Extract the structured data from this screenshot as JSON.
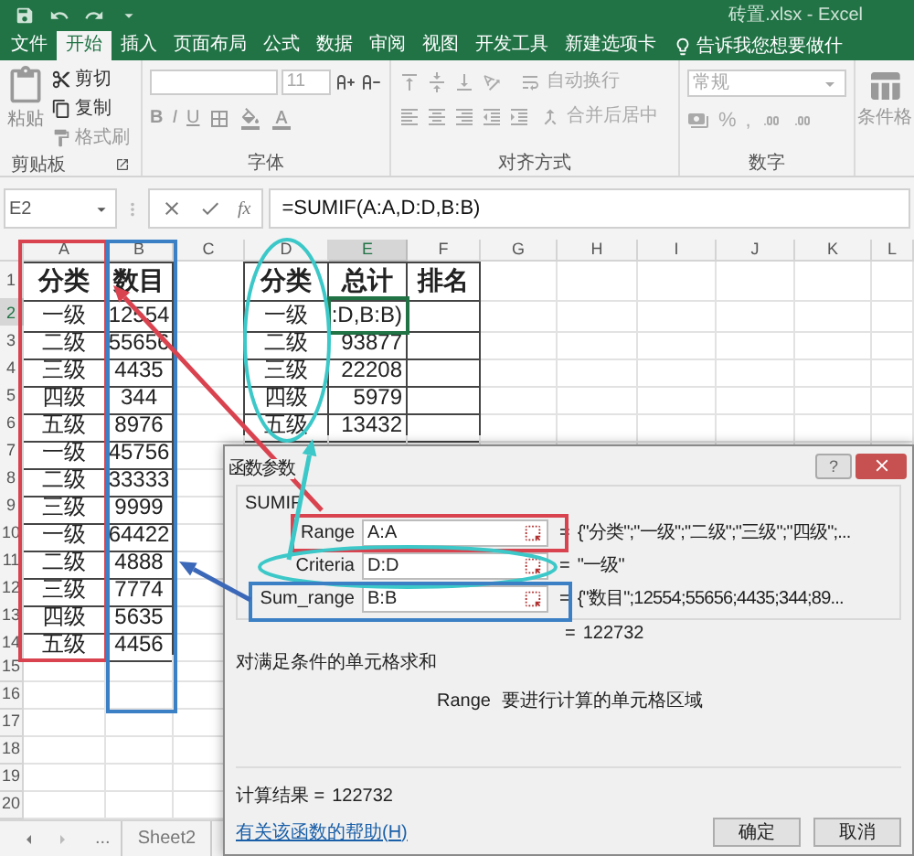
{
  "window": {
    "title": "砖置.xlsx - Excel"
  },
  "ribbon_tabs": [
    {
      "label": "文件",
      "selected": false
    },
    {
      "label": "开始",
      "selected": true
    },
    {
      "label": "插入",
      "selected": false
    },
    {
      "label": "页面布局",
      "selected": false
    },
    {
      "label": "公式",
      "selected": false
    },
    {
      "label": "数据",
      "selected": false
    },
    {
      "label": "审阅",
      "selected": false
    },
    {
      "label": "视图",
      "selected": false
    },
    {
      "label": "开发工具",
      "selected": false
    },
    {
      "label": "新建选项卡",
      "selected": false
    }
  ],
  "tell_me": "告诉我您想要做什",
  "clipboard": {
    "paste": "粘贴",
    "cut": "剪切",
    "copy": "复制",
    "format_painter": "格式刷",
    "label": "剪贴板"
  },
  "font": {
    "size": "11",
    "bold": "B",
    "italic": "I",
    "underline": "U",
    "label": "字体"
  },
  "alignment": {
    "wrap_text": "自动换行",
    "merge_center": "合并后居中",
    "label": "对齐方式"
  },
  "number": {
    "format": "常规",
    "percent": "%",
    "comma": ",",
    "label": "数字"
  },
  "styles": {
    "conditional_formatting": "条件格"
  },
  "formula_bar": {
    "name_box": "E2",
    "fx": "fx",
    "formula": "=SUMIF(A:A,D:D,B:B)"
  },
  "sheet": {
    "columns": [
      "A",
      "B",
      "C",
      "D",
      "E",
      "F",
      "G",
      "H",
      "I",
      "J",
      "K",
      "L"
    ],
    "rows": [
      {
        "number": "1",
        "cells": [
          {
            "text": "分类",
            "selected": false
          },
          {
            "text": "数目",
            "selected": false
          },
          {
            "text": "",
            "selected": false
          },
          {
            "text": "分类",
            "selected": false
          },
          {
            "text": "总计",
            "selected": false
          },
          {
            "text": "排名",
            "selected": false
          }
        ]
      },
      {
        "number": "2",
        "cells": [
          {
            "text": "一级",
            "selected": false
          },
          {
            "text": "12554",
            "selected": false
          },
          {
            "text": "",
            "selected": false
          },
          {
            "text": "一级",
            "selected": false
          },
          {
            "text": ":D,B:B)",
            "selected": true
          }
        ]
      },
      {
        "number": "3",
        "cells": [
          {
            "text": "二级",
            "selected": false
          },
          {
            "text": "55656",
            "selected": false
          },
          {
            "text": "",
            "selected": false
          },
          {
            "text": "二级",
            "selected": false
          },
          {
            "text": "93877",
            "selected": false
          }
        ]
      },
      {
        "number": "4",
        "cells": [
          {
            "text": "三级",
            "selected": false
          },
          {
            "text": "4435",
            "selected": false
          },
          {
            "text": "",
            "selected": false
          },
          {
            "text": "三级",
            "selected": false
          },
          {
            "text": "22208",
            "selected": false
          }
        ]
      },
      {
        "number": "5",
        "cells": [
          {
            "text": "四级",
            "selected": false
          },
          {
            "text": "344",
            "selected": false
          },
          {
            "text": "",
            "selected": false
          },
          {
            "text": "四级",
            "selected": false
          },
          {
            "text": "5979",
            "selected": false
          }
        ]
      },
      {
        "number": "6",
        "cells": [
          {
            "text": "五级",
            "selected": false
          },
          {
            "text": "8976",
            "selected": false
          },
          {
            "text": "",
            "selected": false
          },
          {
            "text": "五级",
            "selected": false
          },
          {
            "text": "13432",
            "selected": false
          }
        ]
      },
      {
        "number": "7",
        "cells": [
          {
            "text": "一级",
            "selected": false
          },
          {
            "text": "45756",
            "selected": false
          }
        ]
      },
      {
        "number": "8",
        "cells": [
          {
            "text": "二级",
            "selected": false
          },
          {
            "text": "33333",
            "selected": false
          }
        ]
      },
      {
        "number": "9",
        "cells": [
          {
            "text": "三级",
            "selected": false
          },
          {
            "text": "9999",
            "selected": false
          }
        ]
      },
      {
        "number": "10",
        "cells": [
          {
            "text": "一级",
            "selected": false
          },
          {
            "text": "64422",
            "selected": false
          }
        ]
      },
      {
        "number": "11",
        "cells": [
          {
            "text": "二级",
            "selected": false
          },
          {
            "text": "4888",
            "selected": false
          }
        ]
      },
      {
        "number": "12",
        "cells": [
          {
            "text": "三级",
            "selected": false
          },
          {
            "text": "7774",
            "selected": false
          }
        ]
      },
      {
        "number": "13",
        "cells": [
          {
            "text": "四级",
            "selected": false
          },
          {
            "text": "5635",
            "selected": false
          }
        ]
      },
      {
        "number": "14",
        "cells": [
          {
            "text": "五级",
            "selected": false
          },
          {
            "text": "4456",
            "selected": false
          }
        ]
      },
      {
        "number": "15",
        "cells": []
      },
      {
        "number": "16",
        "cells": []
      },
      {
        "number": "17",
        "cells": []
      },
      {
        "number": "18",
        "cells": []
      },
      {
        "number": "19",
        "cells": []
      },
      {
        "number": "20",
        "cells": []
      }
    ]
  },
  "sheet_tabs": {
    "more": "...",
    "tabs": [
      {
        "label": "Sheet2",
        "selected": false
      }
    ]
  },
  "dialog": {
    "title": "函数参数",
    "help": "?",
    "function": "SUMIF",
    "arguments": [
      {
        "label": "Range",
        "value": "A:A",
        "equals": "=",
        "result": "{\"分类\";\"一级\";\"二级\";\"三级\";\"四级\";..."
      },
      {
        "label": "Criteria",
        "value": "D:D",
        "equals": "=",
        "result": "\"一级\""
      },
      {
        "label": "Sum_range",
        "value": "B:B",
        "equals": "=",
        "result": "{\"数目\";12554;55656;4435;344;89..."
      }
    ],
    "total_equals": "=",
    "total": "122732",
    "description": "对满足条件的单元格求和",
    "argument_name": "Range",
    "argument_help": "要进行计算的单元格区域",
    "result_label": "计算结果 =",
    "result_value": "122732",
    "help_link": "有关该函数的帮助(H)",
    "buttons": [
      "确定",
      "取消"
    ]
  }
}
